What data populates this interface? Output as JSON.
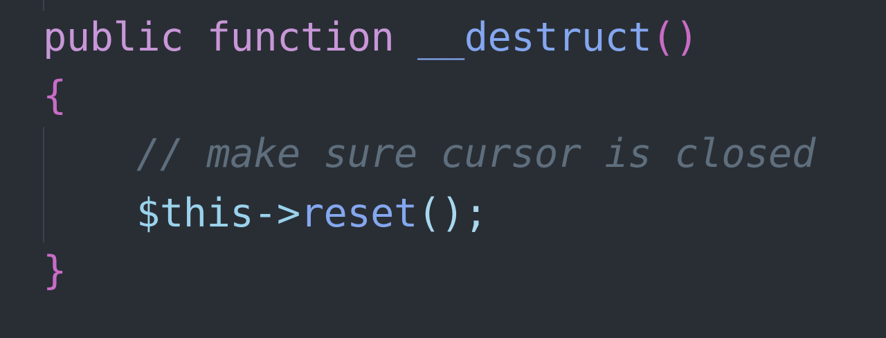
{
  "editor": {
    "colors": {
      "background": "#292e35",
      "keyword": "#c897d8",
      "function": "#84a7ef",
      "bracket": "#c96cc6",
      "comment": "#5f6e7c",
      "variable": "#9ad2ec"
    },
    "lines": {
      "signature": {
        "keyword_public": "public",
        "keyword_function": "function",
        "function_name": "__destruct",
        "parens": "()"
      },
      "open_brace": "{",
      "comment": "// make sure cursor is closed",
      "statement": {
        "variable": "$this",
        "arrow": "->",
        "method": "reset",
        "call_end": "();"
      },
      "close_brace": "}"
    }
  }
}
